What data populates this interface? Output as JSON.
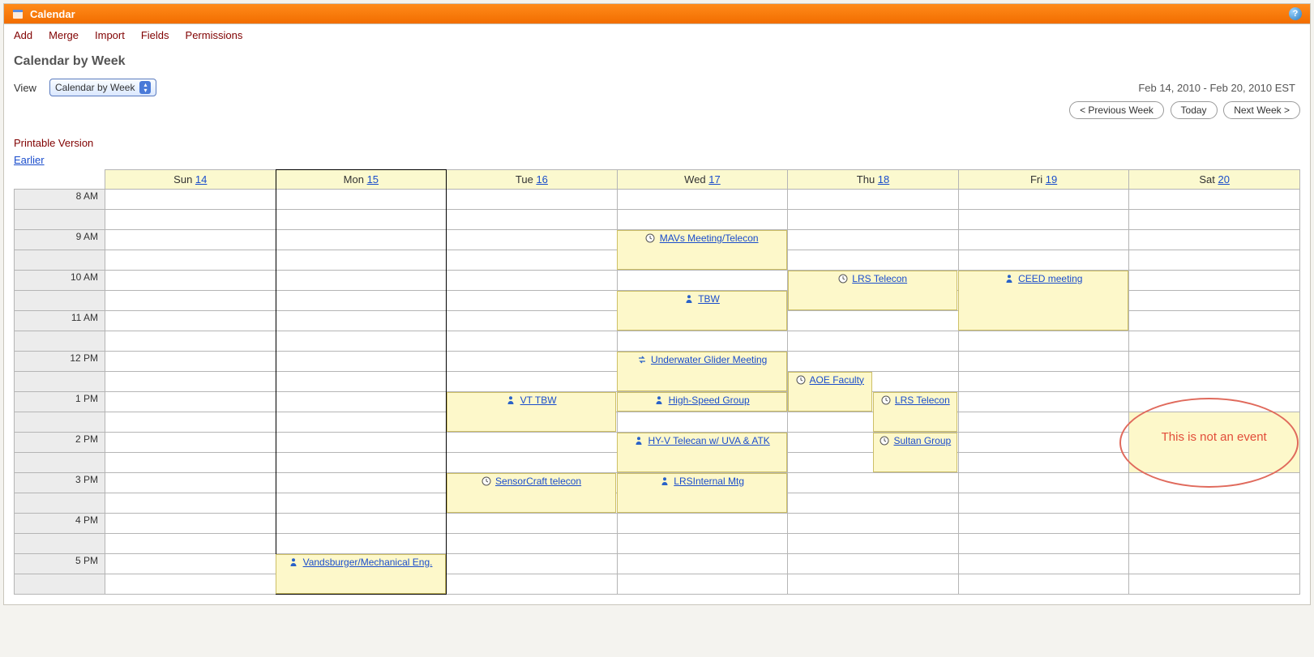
{
  "titleBar": {
    "appName": "Calendar"
  },
  "menu": {
    "add": "Add",
    "merge": "Merge",
    "import": "Import",
    "fields": "Fields",
    "permissions": "Permissions"
  },
  "page": {
    "title": "Calendar by Week",
    "viewLabel": "View",
    "viewSelected": "Calendar by Week",
    "dateRange": "Feb 14, 2010 - Feb 20, 2010 EST",
    "prev": "< Previous Week",
    "today": "Today",
    "next": "Next Week >",
    "printable": "Printable Version",
    "earlier": "Earlier"
  },
  "days": [
    {
      "label": "Sun",
      "num": "14"
    },
    {
      "label": "Mon",
      "num": "15"
    },
    {
      "label": "Tue",
      "num": "16"
    },
    {
      "label": "Wed",
      "num": "17"
    },
    {
      "label": "Thu",
      "num": "18"
    },
    {
      "label": "Fri",
      "num": "19"
    },
    {
      "label": "Sat",
      "num": "20"
    }
  ],
  "hours": [
    "8 AM",
    "9 AM",
    "10 AM",
    "11 AM",
    "12 PM",
    "1 PM",
    "2 PM",
    "3 PM",
    "4 PM",
    "5 PM"
  ],
  "todayIndex": 1,
  "events": [
    {
      "day": 3,
      "startRow": 2,
      "span": 2,
      "icon": "clock",
      "title": "MAVs Meeting/Telecon",
      "col": 0,
      "cols": 1
    },
    {
      "day": 3,
      "startRow": 5,
      "span": 2,
      "icon": "person",
      "title": "TBW",
      "col": 0,
      "cols": 1
    },
    {
      "day": 4,
      "startRow": 4,
      "span": 2,
      "icon": "clock",
      "title": "LRS Telecon",
      "col": 0,
      "cols": 1
    },
    {
      "day": 5,
      "startRow": 4,
      "span": 3,
      "icon": "person",
      "title": "CEED meeting",
      "col": 0,
      "cols": 1
    },
    {
      "day": 3,
      "startRow": 8,
      "span": 2,
      "icon": "swap",
      "title": "Underwater Glider Meeting",
      "col": 0,
      "cols": 1
    },
    {
      "day": 2,
      "startRow": 10,
      "span": 2,
      "icon": "person",
      "title": "VT TBW",
      "col": 0,
      "cols": 1
    },
    {
      "day": 3,
      "startRow": 10,
      "span": 1,
      "icon": "person",
      "title": "High-Speed Group",
      "col": 0,
      "cols": 1
    },
    {
      "day": 4,
      "startRow": 9,
      "span": 2,
      "icon": "clock",
      "title": "AOE Faculty",
      "col": 0,
      "cols": 2
    },
    {
      "day": 4,
      "startRow": 10,
      "span": 2,
      "icon": "clock",
      "title": "LRS Telecon",
      "col": 1,
      "cols": 2
    },
    {
      "day": 3,
      "startRow": 12,
      "span": 2,
      "icon": "person",
      "title": "HY-V Telecan w/ UVA & ATK",
      "col": 0,
      "cols": 1
    },
    {
      "day": 4,
      "startRow": 12,
      "span": 2,
      "icon": "clock",
      "title": "Sultan Group",
      "col": 1,
      "cols": 2
    },
    {
      "day": 2,
      "startRow": 14,
      "span": 2,
      "icon": "clock",
      "title": "SensorCraft telecon",
      "col": 0,
      "cols": 1
    },
    {
      "day": 3,
      "startRow": 14,
      "span": 2,
      "icon": "person",
      "title": "LRSInternal Mtg",
      "col": 0,
      "cols": 1
    },
    {
      "day": 1,
      "startRow": 18,
      "span": 2,
      "icon": "person",
      "title": "Vandsburger/Mechanical Eng.",
      "col": 0,
      "cols": 1
    }
  ],
  "note": {
    "text": "This is not an event"
  }
}
